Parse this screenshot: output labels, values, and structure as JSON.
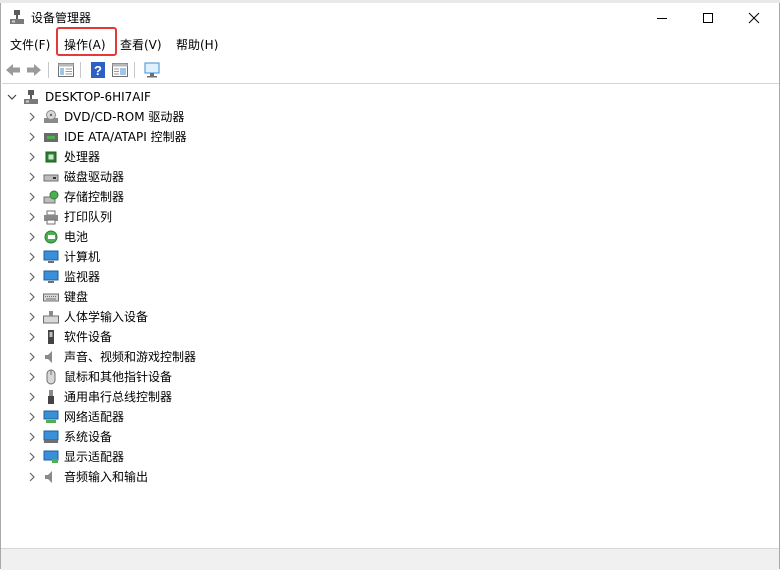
{
  "window": {
    "title": "设备管理器"
  },
  "menu": {
    "items": [
      "文件(F)",
      "操作(A)",
      "查看(V)",
      "帮助(H)"
    ],
    "highlighted_index": 1
  },
  "toolbar": {
    "buttons": [
      "back-icon",
      "forward-icon",
      "show-hide-console-tree-icon",
      "help-icon",
      "properties-icon",
      "scan-hardware-icon"
    ]
  },
  "tree": {
    "root": "DESKTOP-6HI7AIF",
    "categories": [
      "DVD/CD-ROM 驱动器",
      "IDE ATA/ATAPI 控制器",
      "处理器",
      "磁盘驱动器",
      "存储控制器",
      "打印队列",
      "电池",
      "计算机",
      "监视器",
      "键盘",
      "人体学输入设备",
      "软件设备",
      "声音、视频和游戏控制器",
      "鼠标和其他指针设备",
      "通用串行总线控制器",
      "网络适配器",
      "系统设备",
      "显示适配器",
      "音频输入和输出"
    ]
  },
  "colors": {
    "highlight": "#e53935",
    "icon_blue": "#3b8fd6"
  }
}
